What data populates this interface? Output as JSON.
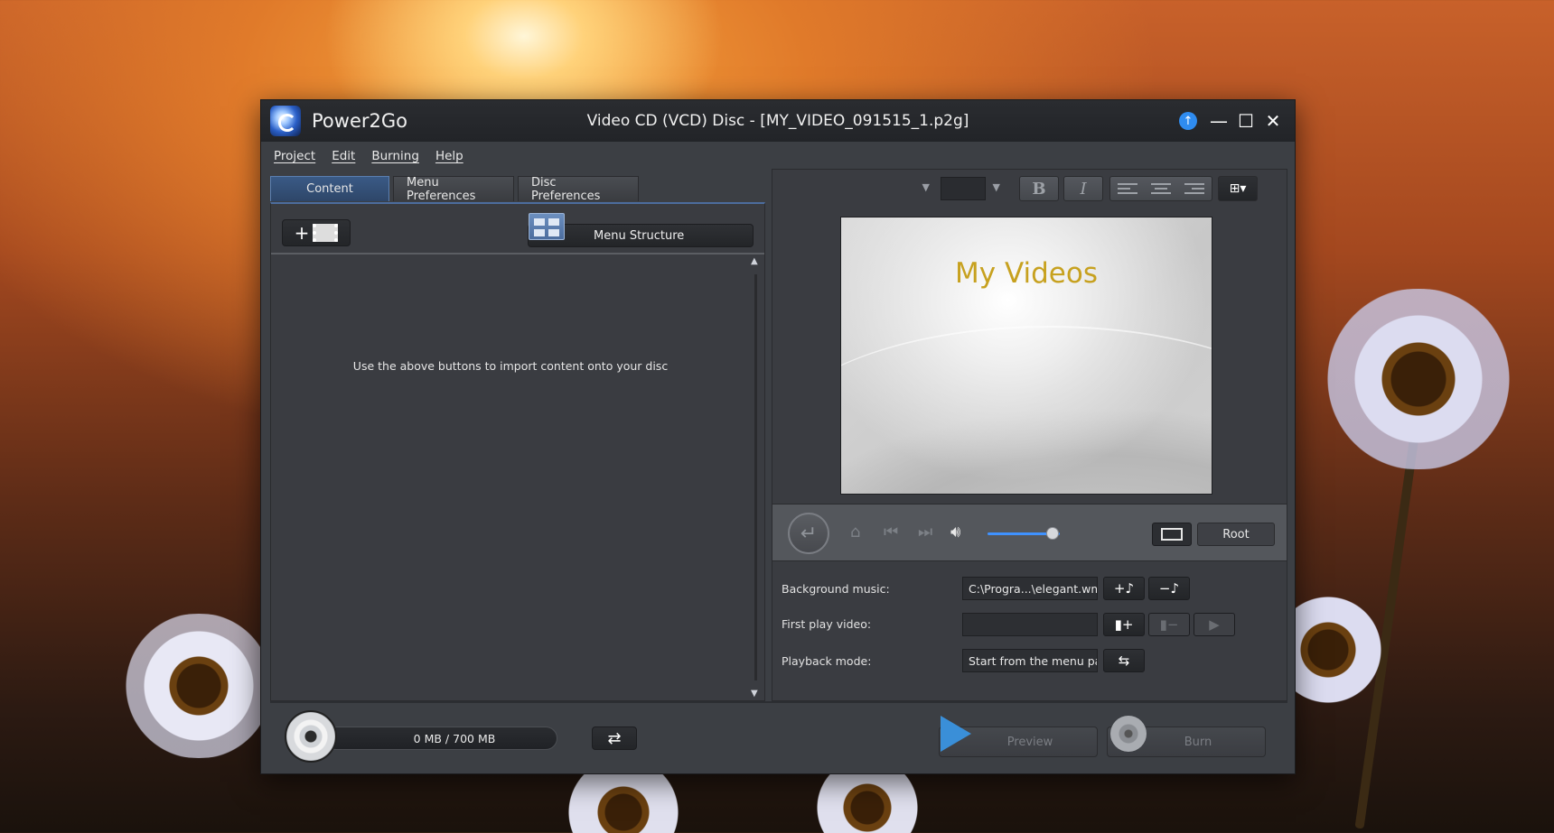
{
  "app": {
    "name": "Power2Go",
    "window_title": "Video CD (VCD) Disc - [MY_VIDEO_091515_1.p2g]"
  },
  "menubar": {
    "items": [
      "Project",
      "Edit",
      "Burning",
      "Help"
    ]
  },
  "tabs": [
    {
      "label": "Content",
      "active": true
    },
    {
      "label": "Menu Preferences",
      "active": false
    },
    {
      "label": "Disc Preferences",
      "active": false
    }
  ],
  "content": {
    "menu_structure_label": "Menu Structure",
    "empty_hint": "Use the above buttons to import content onto your disc"
  },
  "preview": {
    "menu_title": "My Videos",
    "title_color": "#c7a11f",
    "volume_level": 0.9,
    "root_label": "Root"
  },
  "settings": {
    "background_music_label": "Background music:",
    "background_music_value": "C:\\Progra...\\elegant.wma",
    "first_play_label": "First play video:",
    "first_play_value": "",
    "playback_mode_label": "Playback mode:",
    "playback_mode_value": "Start from the menu pa..."
  },
  "bottom": {
    "capacity": "0 MB / 700 MB",
    "preview_label": "Preview",
    "burn_label": "Burn"
  },
  "colors": {
    "accent": "#3f92ff",
    "update_badge": "#2f8cf0"
  }
}
